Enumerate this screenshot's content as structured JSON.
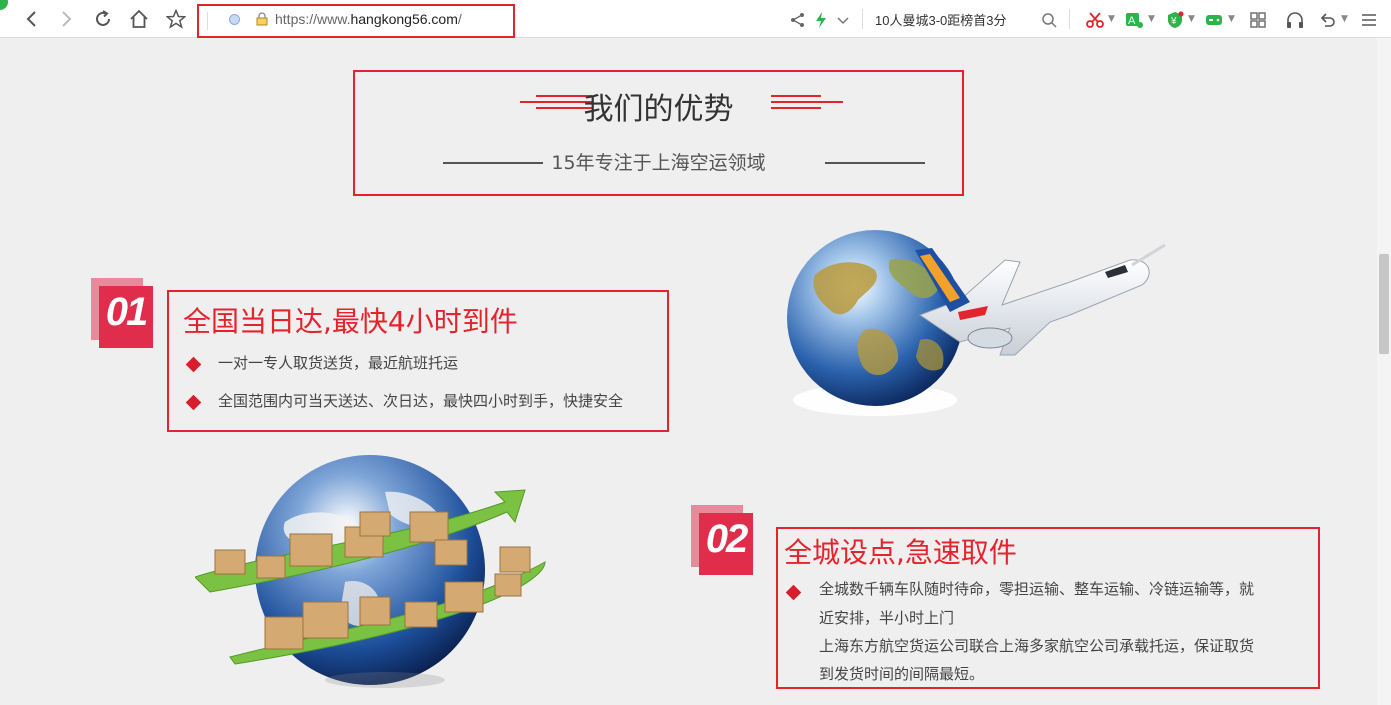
{
  "browser": {
    "url_prefix": "https://www.",
    "url_host": "hangkong56.com",
    "url_suffix": "/",
    "news_text": "10人曼城3-0距榜首3分"
  },
  "section": {
    "title": "我们的优势",
    "subtitle": "15年专注于上海空运领域"
  },
  "features": [
    {
      "number": "01",
      "title": "全国当日达,最快4小时到件",
      "points": [
        "一对一专人取货送货，最近航班托运",
        "全国范围内可当天送达、次日达，最快四小时到手，快捷安全"
      ]
    },
    {
      "number": "02",
      "title": "全城设点,急速取件",
      "lines": [
        "全城数千辆车队随时待命，零担运输、整车运输、冷链运输等，就",
        "近安排，半小时上门",
        "上海东方航空货运公司联合上海多家航空公司承载托运，保证取货",
        "到发货时间的间隔最短。"
      ]
    }
  ],
  "colors": {
    "accent": "#e4242c",
    "badge": "#df2d4b",
    "background": "#efefef"
  },
  "icons": [
    "back-icon",
    "forward-icon",
    "refresh-icon",
    "home-icon",
    "star-icon",
    "lock-icon",
    "share-icon",
    "flash-icon",
    "search-icon",
    "scissors-icon",
    "translate-icon",
    "wallet-icon",
    "game-icon",
    "apps-icon",
    "headphones-icon",
    "undo-icon",
    "menu-icon"
  ]
}
